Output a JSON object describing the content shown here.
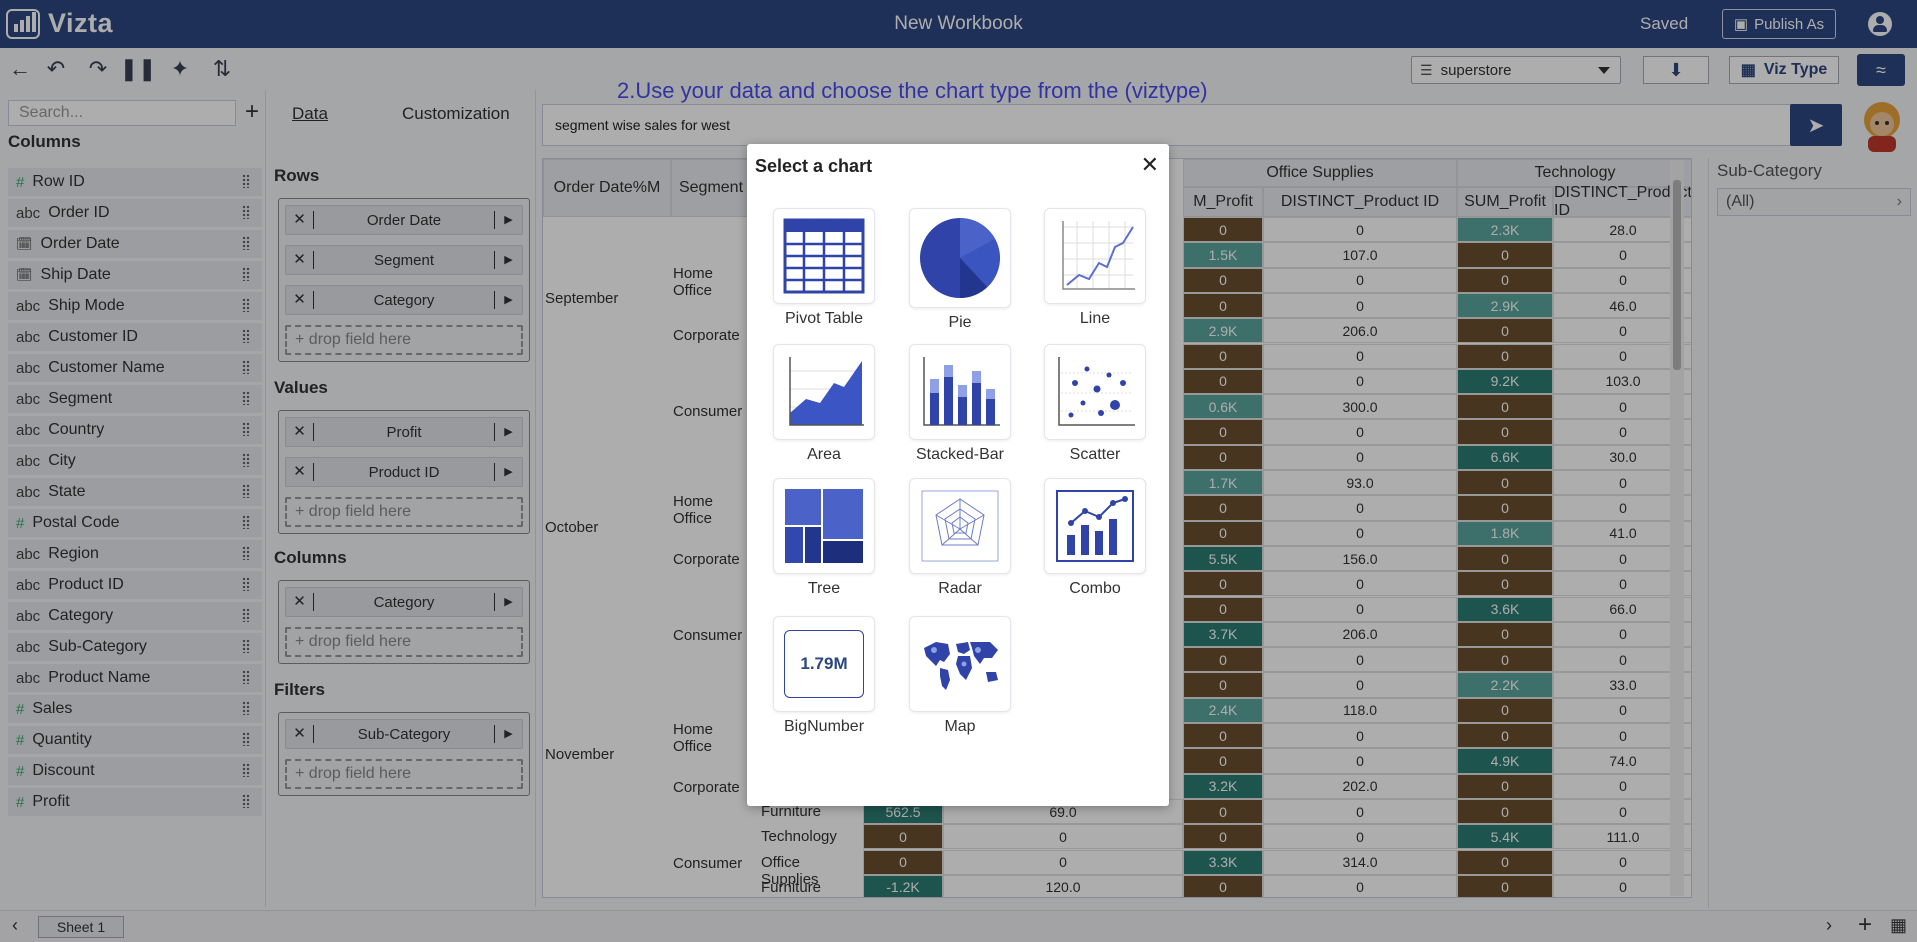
{
  "header": {
    "app_name": "Vizta",
    "workbook_title": "New Workbook",
    "status": "Saved",
    "publish_label": "Publish As"
  },
  "toolbar": {
    "datasource": "superstore",
    "viztype_label": "Viz Type"
  },
  "fields_panel": {
    "search_placeholder": "Search...",
    "columns_title": "Columns",
    "fields": [
      {
        "type": "#",
        "name": "Row ID"
      },
      {
        "type": "abc",
        "name": "Order ID"
      },
      {
        "type": "date",
        "name": "Order Date"
      },
      {
        "type": "date",
        "name": "Ship Date"
      },
      {
        "type": "abc",
        "name": "Ship Mode"
      },
      {
        "type": "abc",
        "name": "Customer ID"
      },
      {
        "type": "abc",
        "name": "Customer Name"
      },
      {
        "type": "abc",
        "name": "Segment"
      },
      {
        "type": "abc",
        "name": "Country"
      },
      {
        "type": "abc",
        "name": "City"
      },
      {
        "type": "abc",
        "name": "State"
      },
      {
        "type": "#",
        "name": "Postal Code"
      },
      {
        "type": "abc",
        "name": "Region"
      },
      {
        "type": "abc",
        "name": "Product ID"
      },
      {
        "type": "abc",
        "name": "Category"
      },
      {
        "type": "abc",
        "name": "Sub-Category"
      },
      {
        "type": "abc",
        "name": "Product Name"
      },
      {
        "type": "#",
        "name": "Sales"
      },
      {
        "type": "#",
        "name": "Quantity"
      },
      {
        "type": "#",
        "name": "Discount"
      },
      {
        "type": "#",
        "name": "Profit"
      }
    ]
  },
  "config_panel": {
    "tab_data": "Data",
    "tab_customization": "Customization",
    "rows_title": "Rows",
    "rows": [
      "Order Date",
      "Segment",
      "Category"
    ],
    "values_title": "Values",
    "values": [
      "Profit",
      "Product ID"
    ],
    "columns_title": "Columns",
    "columns": [
      "Category"
    ],
    "filters_title": "Filters",
    "filters": [
      "Sub-Category"
    ],
    "drop_placeholder": "+ drop field here"
  },
  "annotation": "2.Use your data and choose the chart type from the (viztype)",
  "query": "segment wise sales for west",
  "table": {
    "header_order_date": "Order Date%M",
    "header_segment": "Segment",
    "group_office": "Office Supplies",
    "group_tech": "Technology",
    "col_sum_profit_partial": "M_Profit",
    "col_distinct": "DISTINCT_Product ID",
    "col_sum_profit": "SUM_Profit",
    "months": [
      "September",
      "October",
      "November"
    ],
    "segments": [
      "Home Office",
      "Corporate",
      "Consumer"
    ],
    "bottom_categories": [
      "Furniture",
      "Technology",
      "Office Supplies",
      "Furniture"
    ],
    "bottom_rows": [
      [
        "562.5",
        "69.0",
        "0",
        "0",
        "0",
        "0"
      ],
      [
        "0",
        "0",
        "0",
        "0",
        "5.4K",
        "111.0"
      ],
      [
        "0",
        "0",
        "3.3K",
        "314.0",
        "0",
        "0"
      ],
      [
        "-1.2K",
        "120.0",
        "0",
        "0",
        "0",
        "0"
      ]
    ],
    "rows": [
      [
        "0",
        "0",
        "2.3K",
        "28.0"
      ],
      [
        "1.5K",
        "107.0",
        "0",
        "0"
      ],
      [
        "0",
        "0",
        "0",
        "0"
      ],
      [
        "0",
        "0",
        "2.9K",
        "46.0"
      ],
      [
        "2.9K",
        "206.0",
        "0",
        "0"
      ],
      [
        "0",
        "0",
        "0",
        "0"
      ],
      [
        "0",
        "0",
        "9.2K",
        "103.0"
      ],
      [
        "0.6K",
        "300.0",
        "0",
        "0"
      ],
      [
        "0",
        "0",
        "0",
        "0"
      ],
      [
        "0",
        "0",
        "6.6K",
        "30.0"
      ],
      [
        "1.7K",
        "93.0",
        "0",
        "0"
      ],
      [
        "0",
        "0",
        "0",
        "0"
      ],
      [
        "0",
        "0",
        "1.8K",
        "41.0"
      ],
      [
        "5.5K",
        "156.0",
        "0",
        "0"
      ],
      [
        "0",
        "0",
        "0",
        "0"
      ],
      [
        "0",
        "0",
        "3.6K",
        "66.0"
      ],
      [
        "3.7K",
        "206.0",
        "0",
        "0"
      ],
      [
        "0",
        "0",
        "0",
        "0"
      ],
      [
        "0",
        "0",
        "2.2K",
        "33.0"
      ],
      [
        "2.4K",
        "118.0",
        "0",
        "0"
      ],
      [
        "0",
        "0",
        "0",
        "0"
      ],
      [
        "0",
        "0",
        "4.9K",
        "74.0"
      ],
      [
        "3.2K",
        "202.0",
        "0",
        "0"
      ]
    ]
  },
  "right_panel": {
    "filter_title": "Sub-Category",
    "filter_value": "(All)"
  },
  "bottom": {
    "sheet_tab": "Sheet 1"
  },
  "modal": {
    "title": "Select a chart",
    "big_number_sample": "1.79M",
    "options": [
      "Pivot Table",
      "Pie",
      "Line",
      "Area",
      "Stacked-Bar",
      "Scatter",
      "Tree",
      "Radar",
      "Combo",
      "BigNumber",
      "Map"
    ]
  }
}
